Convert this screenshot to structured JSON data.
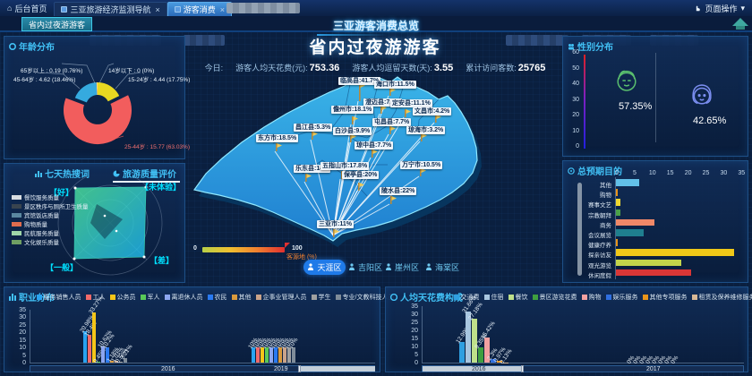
{
  "topbar": {
    "home_label": "后台首页",
    "tabs": [
      {
        "label": "三亚旅游经济监测导航",
        "close": "×"
      },
      {
        "label": "游客消费",
        "close": "×"
      }
    ],
    "page_ops_label": "页面操作",
    "caret": "▾"
  },
  "subbar": {
    "active_tab": "省内过夜游游客",
    "title": "三亚游客消费总览"
  },
  "overview": {
    "title": "省内过夜游游客",
    "today_label": "今日:",
    "stats": [
      {
        "label": "游客人均天花费(元):",
        "value": "753.36"
      },
      {
        "label": "游客人均逗留天数(天):",
        "value": "3.55"
      },
      {
        "label": "累计访问客数:",
        "value": "25765"
      }
    ]
  },
  "map": {
    "legend_min": "0",
    "legend_max": "100",
    "legend_label": "客源地 (%)",
    "regions": [
      {
        "name": "临高县",
        "pct": "41.7%"
      },
      {
        "name": "海口市",
        "pct": "11.5%"
      },
      {
        "name": "澄迈县",
        "pct": "7.3%"
      },
      {
        "name": "儋州市",
        "pct": "18.1%"
      },
      {
        "name": "定安县",
        "pct": "11.1%"
      },
      {
        "name": "文昌市",
        "pct": "4.2%"
      },
      {
        "name": "屯昌县",
        "pct": "7.7%"
      },
      {
        "name": "琼海市",
        "pct": "3.2%"
      },
      {
        "name": "昌江县",
        "pct": "5.3%"
      },
      {
        "name": "白沙县",
        "pct": "9.9%"
      },
      {
        "name": "东方市",
        "pct": "18.5%"
      },
      {
        "name": "琼中县",
        "pct": "7.7%"
      },
      {
        "name": "万宁市",
        "pct": "10.5%"
      },
      {
        "name": "乐东县",
        "pct": "14%"
      },
      {
        "name": "五指山市",
        "pct": "17.8%"
      },
      {
        "name": "保亭县",
        "pct": "20%"
      },
      {
        "name": "陵水县",
        "pct": "22%"
      },
      {
        "name": "三亚市",
        "pct": "11%"
      }
    ],
    "districts": [
      {
        "label": "天涯区",
        "active": true
      },
      {
        "label": "吉阳区",
        "active": false
      },
      {
        "label": "崖州区",
        "active": false
      },
      {
        "label": "海棠区",
        "active": false
      }
    ]
  },
  "age": {
    "title": "年龄分布",
    "slices": [
      {
        "name": "14岁以下",
        "value": 0,
        "pct": "0%",
        "label": "14岁以下 : 0 (0%)",
        "color": "#2b9fd4"
      },
      {
        "name": "15-24岁",
        "value": 4.44,
        "pct": "17.75%",
        "label": "15-24岁 : 4.44 (17.75%)",
        "color": "#e8d821"
      },
      {
        "name": "25-44岁",
        "value": 15.77,
        "pct": "63.03%",
        "label": "25-44岁 : 15.77 (63.03%)",
        "color": "#f25d5d"
      },
      {
        "name": "45-64岁",
        "value": 4.62,
        "pct": "18.46%",
        "label": "45-64岁 : 4.62 (18.46%)",
        "color": "#35aadf"
      },
      {
        "name": "65岁以上",
        "value": 0.19,
        "pct": "0.76%",
        "label": "65岁以上 : 0.19 (0.76%)",
        "color": "#ffd27f"
      }
    ]
  },
  "quality": {
    "tab_hot": "七天热搜词",
    "tab_quality": "旅游质量评价",
    "corners": [
      "【好】",
      "【未体验】",
      "【差】",
      "【一般】"
    ],
    "legend": [
      {
        "label": "餐饮服务质量",
        "color": "#d8dde2"
      },
      {
        "label": "景区秩序与厕所卫生质量",
        "color": "#39444f"
      },
      {
        "label": "宾馆饭店质量",
        "color": "#5a87a0"
      },
      {
        "label": "购物质量",
        "color": "#e06c4e"
      },
      {
        "label": "民航服务质量",
        "color": "#9fd6a8"
      },
      {
        "label": "文化娱乐质量",
        "color": "#6f9f63"
      }
    ]
  },
  "gender": {
    "title": "性别分布",
    "yticks": [
      "60",
      "50",
      "40",
      "30",
      "20",
      "10",
      "0"
    ],
    "male_pct": "57.35%",
    "female_pct": "42.65%"
  },
  "purpose": {
    "title": "总预期目的",
    "xticks": [
      "0",
      "5",
      "10",
      "15",
      "20",
      "25",
      "30",
      "35"
    ],
    "items": [
      {
        "label": "其他",
        "value": 6.5,
        "color": "#62c0e8"
      },
      {
        "label": "购物",
        "value": 0.4,
        "color": "#e8941a"
      },
      {
        "label": "赛事文艺",
        "value": 1.2,
        "color": "#f0d830"
      },
      {
        "label": "宗教朝拜",
        "value": 1.3,
        "color": "#4aa048"
      },
      {
        "label": "商务",
        "value": 10.8,
        "color": "#f08868"
      },
      {
        "label": "会议展览",
        "value": 7.8,
        "color": "#1f7f8f"
      },
      {
        "label": "健康疗养",
        "value": 0.5,
        "color": "#e8941a"
      },
      {
        "label": "探亲访友",
        "value": 33.2,
        "color": "#f0c818"
      },
      {
        "label": "观光游览",
        "value": 18.3,
        "color": "#c3d44a"
      },
      {
        "label": "休闲度假",
        "value": 21.1,
        "color": "#d93636"
      }
    ]
  },
  "occupation": {
    "title": "职业分布",
    "yticks": [
      "35",
      "30",
      "25",
      "20",
      "15",
      "10",
      "5",
      "0"
    ],
    "legend": [
      {
        "label": "服务销售人员",
        "color": "#29a3f0"
      },
      {
        "label": "工人",
        "color": "#f06a6a"
      },
      {
        "label": "公务员",
        "color": "#f5c518"
      },
      {
        "label": "军人",
        "color": "#58c958"
      },
      {
        "label": "离退休人员",
        "color": "#8ca6f0"
      },
      {
        "label": "农民",
        "color": "#2979f0"
      },
      {
        "label": "其他",
        "color": "#d99a3d"
      },
      {
        "label": "企事业管理人员",
        "color": "#c9a38a"
      },
      {
        "label": "学生",
        "color": "#a0a0a0"
      },
      {
        "label": "专业/文教科技人员",
        "color": "#7f8c99"
      }
    ],
    "groups": [
      {
        "year": "2016",
        "values": [
          20.98,
          18.4,
          33.27,
          0.45,
          10.62,
          10.2,
          1.18,
          1.03,
          0.56,
          3.21
        ],
        "labels": [
          "20.98%",
          "18.4%",
          "33.27%",
          "0.45%",
          "10.62%",
          "10.2%",
          "1.18%",
          "1.03%",
          "0.56%",
          "3.21%"
        ]
      },
      {
        "year": "2019",
        "values": [
          10,
          10,
          10,
          10,
          10,
          10,
          10,
          10,
          10,
          10
        ],
        "labels": [
          "10%",
          "10%",
          "10%",
          "10%",
          "10%",
          "10%",
          "10%",
          "10%",
          "10%",
          "10%"
        ]
      }
    ]
  },
  "spending": {
    "title": "人均天花费构成",
    "yticks": [
      "35",
      "30",
      "25",
      "20",
      "15",
      "10",
      "5",
      "0"
    ],
    "legend": [
      {
        "label": "交通费",
        "color": "#2f9fe0"
      },
      {
        "label": "住宿",
        "color": "#a8c6e0"
      },
      {
        "label": "餐饮",
        "color": "#bfe08a"
      },
      {
        "label": "景区游览花费",
        "color": "#3f9f3f"
      },
      {
        "label": "购物",
        "color": "#f2a0a0"
      },
      {
        "label": "娱乐服务",
        "color": "#2f6fe0"
      },
      {
        "label": "其他专项服务",
        "color": "#e8941a"
      },
      {
        "label": "租赁及保养维修服务",
        "color": "#d8b896"
      }
    ],
    "groups": [
      {
        "year": "2016",
        "values": [
          12.99,
          31.66,
          27.18,
          9.35,
          15.42,
          2.3,
          0.97,
          0.13
        ],
        "labels": [
          "12.99%",
          "31.66%",
          "27.18%",
          "9.35%",
          "15.42%",
          "2.3%",
          "0.97%",
          "0.13%"
        ]
      },
      {
        "year": "2017",
        "values": [
          0,
          0,
          0,
          0,
          0,
          0,
          0,
          0
        ],
        "labels": [
          "0%",
          "0%",
          "0%",
          "0%",
          "0%",
          "0%",
          "0%",
          "0%"
        ]
      }
    ]
  },
  "chart_data": [
    {
      "type": "pie",
      "title": "年龄分布",
      "categories": [
        "14岁以下",
        "15-24岁",
        "25-44岁",
        "45-64岁",
        "65岁以上"
      ],
      "values": [
        0,
        17.75,
        63.03,
        18.46,
        0.76
      ]
    },
    {
      "type": "bar",
      "title": "总预期目的",
      "categories": [
        "其他",
        "购物",
        "赛事文艺",
        "宗教朝拜",
        "商务",
        "会议展览",
        "健康疗养",
        "探亲访友",
        "观光游览",
        "休闲度假"
      ],
      "values": [
        6.5,
        0.4,
        1.2,
        1.3,
        10.8,
        7.8,
        0.5,
        33.2,
        18.3,
        21.1
      ],
      "xlim": [
        0,
        35
      ]
    },
    {
      "type": "bar",
      "title": "职业分布",
      "categories": [
        "2016",
        "2019"
      ],
      "series_names": [
        "服务销售人员",
        "工人",
        "公务员",
        "军人",
        "离退休人员",
        "农民",
        "其他",
        "企事业管理人员",
        "学生",
        "专业/文教科技人员"
      ],
      "series": [
        [
          20.98,
          10
        ],
        [
          18.4,
          10
        ],
        [
          33.27,
          10
        ],
        [
          0.45,
          10
        ],
        [
          10.62,
          10
        ],
        [
          10.2,
          10
        ],
        [
          1.18,
          10
        ],
        [
          1.03,
          10
        ],
        [
          0.56,
          10
        ],
        [
          3.21,
          10
        ]
      ],
      "ylim": [
        0,
        35
      ]
    },
    {
      "type": "bar",
      "title": "人均天花费构成",
      "categories": [
        "2016",
        "2017"
      ],
      "series_names": [
        "交通费",
        "住宿",
        "餐饮",
        "景区游览花费",
        "购物",
        "娱乐服务",
        "其他专项服务",
        "租赁及保养维修服务"
      ],
      "series": [
        [
          12.99,
          0
        ],
        [
          31.66,
          0
        ],
        [
          27.18,
          0
        ],
        [
          9.35,
          0
        ],
        [
          15.42,
          0
        ],
        [
          2.3,
          0
        ],
        [
          0.97,
          0
        ],
        [
          0.13,
          0
        ]
      ],
      "ylim": [
        0,
        35
      ]
    }
  ]
}
